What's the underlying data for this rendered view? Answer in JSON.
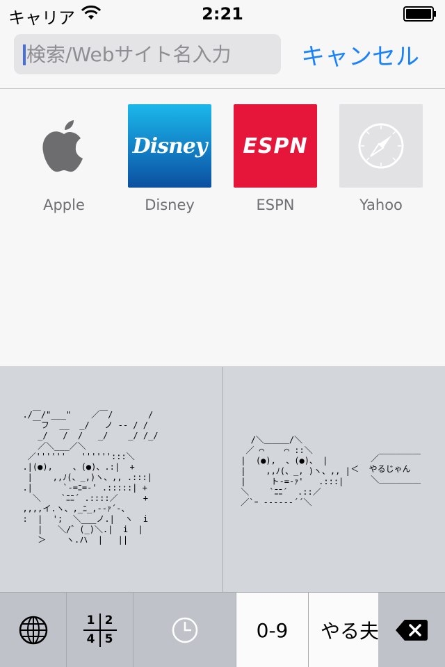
{
  "status_bar": {
    "carrier": "キャリア",
    "time": "2:21"
  },
  "search": {
    "placeholder": "検索/Webサイト名入力",
    "value": "",
    "cancel_label": "キャンセル"
  },
  "favorites": [
    {
      "label": "Apple",
      "icon": "apple-logo"
    },
    {
      "label": "Disney",
      "icon": "disney-logo",
      "logo_text": "Disney"
    },
    {
      "label": "ESPN",
      "icon": "espn-logo",
      "logo_text": "ESPN"
    },
    {
      "label": "Yahoo",
      "icon": "compass-icon"
    }
  ],
  "keyboard": {
    "aa_left": "  ./￣/\"___\"    ／￣/       /\n    ￣フ  __  _/   ノ ‐‐ / /\n     _/   /  /   _/    _/ /_/\n     ／＼___／＼\n   ／''''''   '''''':::＼\n  .|(●),    、(●)、.:|  +\n   |    ,,ﾉ(、_,)ヽ、,, .:::|\n  .|      `-=ﾆ=-' .:::::| +\n    ＼    `ﾆﾆ´ .::::／     +\n  ,,,,イ.ヽ、,_ﾆ_,‐‐ｧ´-、\n  :  |  ';  ＼___ノ.|  ヽ  i\n     |   ＼/゛(_)＼.|  i  |\n     ＞    ヽ.ハ  |   ||",
    "aa_right_face": "   /＼＿＿＿/＼\n  ／ ⌒    ⌒ ::＼\n |  (●),  、(●)、 |\n |    ,,ﾉ(、_, )ヽ、,, |\n |     ト‐=‐ｧ'   .:::|\n ＼    `ﾆﾆ´  .::／\n ／`ｰ ‐‐‐‐‐‐´´＼",
    "aa_right_bubble": "     ／￣￣￣￣￣\n ＜  やるじゃん\n     ＼＿＿＿＿＿",
    "digits_label": "0-9",
    "yaruo_label": "やる夫",
    "globe_icon": "globe-icon",
    "fraction_icon": "fraction-icon",
    "fraction_digits": [
      "1",
      "2",
      "4",
      "5"
    ],
    "recent_icon": "clock-icon",
    "delete_icon": "delete-icon"
  },
  "colors": {
    "accent": "#1a82fb",
    "espn_red": "#e5163a",
    "disney_blue": "#1384c9"
  }
}
